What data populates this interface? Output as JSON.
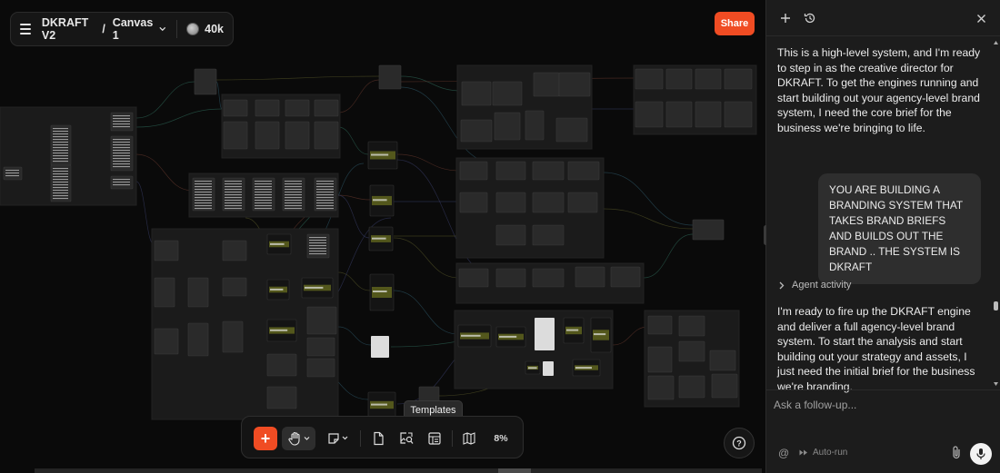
{
  "header": {
    "project_name": "DKRAFT V2",
    "separator": "/",
    "canvas_name": "Canvas 1",
    "credits": "40k",
    "share_label": "Share"
  },
  "toolbar": {
    "tooltip": "Templates",
    "zoom": "8%",
    "add_label": "+"
  },
  "help": {
    "label": "?"
  },
  "panel": {
    "messages": {
      "agent_1": "This is a high-level system, and I'm ready to step in as the creative director for DKRAFT. To get the engines running and start building out your agency-level brand system, I need the core brief for the business we're bringing to life.",
      "user_1": "YOU ARE BUILDING A BRANDING SYSTEM THAT TAKES BRAND BRIEFS AND BUILDS OUT THE BRAND .. THE SYSTEM IS DKRAFT",
      "agent_2": "I'm ready to fire up the DKRAFT engine and deliver a full agency-level brand system. To start the analysis and start building out your strategy and assets, I just need the initial brief for the business we're branding."
    },
    "activity_label": "Agent activity",
    "followup_placeholder": "Ask a follow-up...",
    "at_label": "@",
    "autorun_label": "Auto-run"
  },
  "colors": {
    "accent": "#f04c23",
    "canvas_bg": "#0a0a0a",
    "panel_bg": "#1c1c1c"
  },
  "icons": [
    "menu-icon",
    "chevron-down-icon",
    "coin-icon",
    "plus-icon",
    "history-icon",
    "close-icon",
    "chevron-right-icon",
    "hand-icon",
    "sticky-note-icon",
    "document-icon",
    "image-search-icon",
    "templates-icon",
    "map-icon",
    "help-icon",
    "paperclip-icon",
    "microphone-icon"
  ]
}
